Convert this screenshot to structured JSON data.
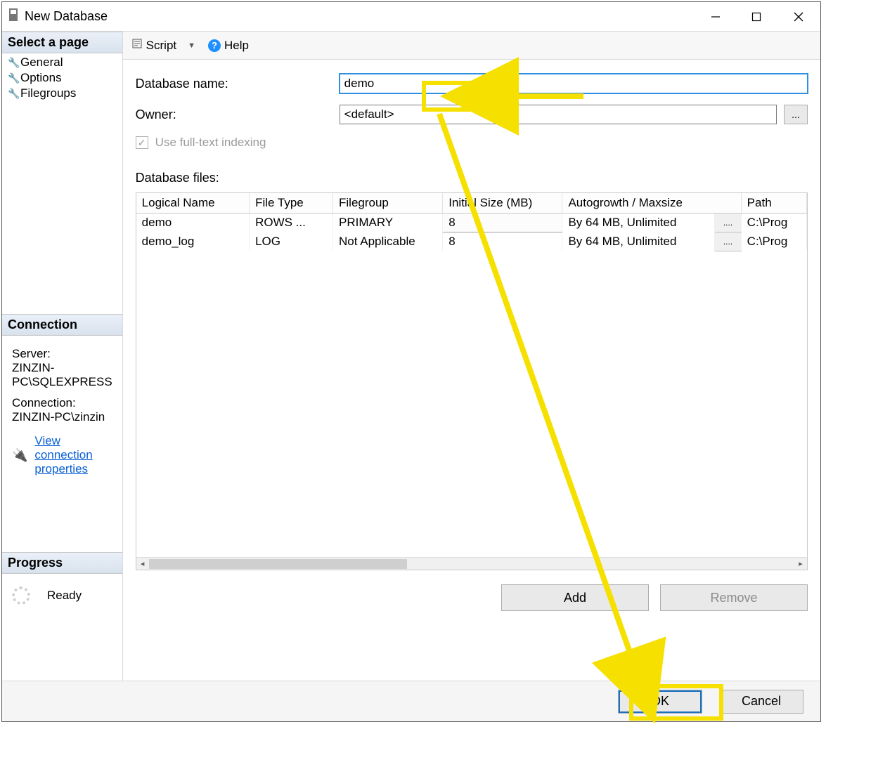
{
  "window": {
    "title": "New Database"
  },
  "sidebar": {
    "select_page_header": "Select a page",
    "pages": [
      {
        "label": "General"
      },
      {
        "label": "Options"
      },
      {
        "label": "Filegroups"
      }
    ],
    "connection_header": "Connection",
    "server_label": "Server:",
    "server_value": "ZINZIN-PC\\SQLEXPRESS",
    "connection_label": "Connection:",
    "connection_value": "ZINZIN-PC\\zinzin",
    "view_connection_link": "View connection properties",
    "progress_header": "Progress",
    "progress_status": "Ready"
  },
  "toolbar": {
    "script_label": "Script",
    "help_label": "Help"
  },
  "form": {
    "dbname_label": "Database name:",
    "dbname_value": "demo",
    "owner_label": "Owner:",
    "owner_value": "<default>",
    "fulltext_label": "Use full-text indexing",
    "files_label": "Database files:"
  },
  "grid": {
    "columns": {
      "logical_name": "Logical Name",
      "file_type": "File Type",
      "filegroup": "Filegroup",
      "initial_size": "Initial Size (MB)",
      "autogrowth": "Autogrowth / Maxsize",
      "path": "Path"
    },
    "rows": [
      {
        "logical_name": "demo",
        "file_type": "ROWS ...",
        "filegroup": "PRIMARY",
        "initial_size": "8",
        "autogrowth": "By 64 MB, Unlimited",
        "path": "C:\\Prog"
      },
      {
        "logical_name": "demo_log",
        "file_type": "LOG",
        "filegroup": "Not Applicable",
        "initial_size": "8",
        "autogrowth": "By 64 MB, Unlimited",
        "path": "C:\\Prog"
      }
    ],
    "ellipsis": "...."
  },
  "buttons": {
    "add": "Add",
    "remove": "Remove",
    "ok": "OK",
    "cancel": "Cancel",
    "browse": "..."
  }
}
